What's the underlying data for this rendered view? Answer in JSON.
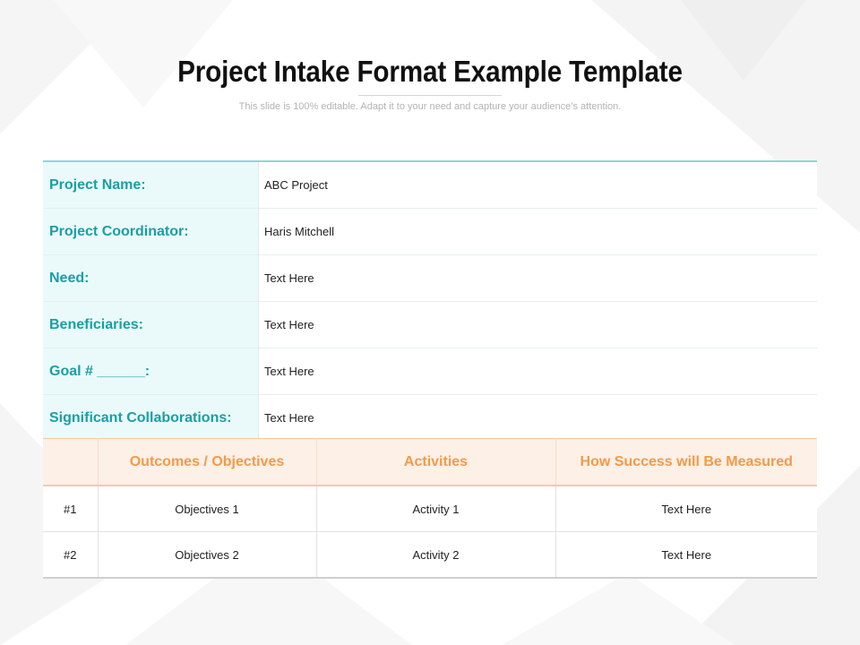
{
  "header": {
    "title": "Project Intake Format Example Template",
    "subtitle": "This slide is 100% editable. Adapt it to your need and capture your audience’s attention."
  },
  "intake": {
    "rows": [
      {
        "label": "Project Name:",
        "value": "ABC Project"
      },
      {
        "label": "Project Coordinator:",
        "value": "Haris Mitchell"
      },
      {
        "label": "Need:",
        "value": "Text Here"
      },
      {
        "label": "Beneficiaries:",
        "value": "Text Here"
      },
      {
        "label": "Goal # ______:",
        "value": "Text Here"
      },
      {
        "label": "Significant Collaborations:",
        "value": "Text Here"
      }
    ]
  },
  "outcomes": {
    "headers": [
      "",
      "Outcomes / Objectives",
      "Activities",
      "How Success will Be Measured"
    ],
    "rows": [
      [
        "#1",
        "Objectives 1",
        "Activity 1",
        "Text Here"
      ],
      [
        "#2",
        "Objectives 2",
        "Activity 2",
        "Text Here"
      ]
    ]
  },
  "colors": {
    "teal_label": "#1a9ea5",
    "teal_fill": "#eafafb",
    "orange_header": "#f29a4a",
    "orange_fill": "#fdf0e6"
  }
}
